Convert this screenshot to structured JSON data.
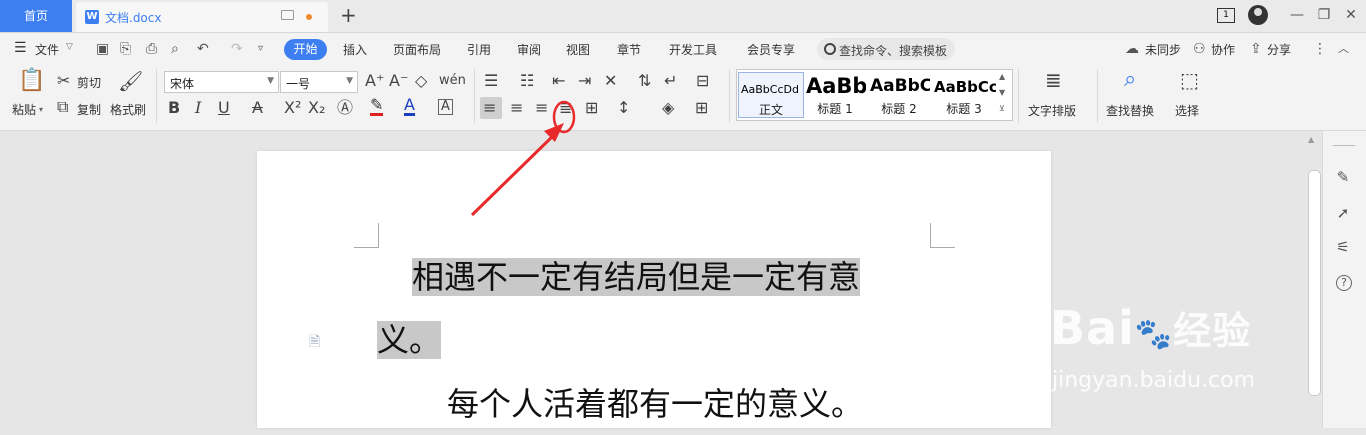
{
  "titlebar": {
    "home_tab": "首页",
    "doc_tab": "文档.docx",
    "doc_icon": "W",
    "new_tab": "+",
    "window_count": "1",
    "min": "—",
    "restore": "❐",
    "close": "✕"
  },
  "menu": {
    "file": "文件",
    "tabs": [
      "开始",
      "插入",
      "页面布局",
      "引用",
      "审阅",
      "视图",
      "章节",
      "开发工具",
      "会员专享"
    ],
    "search": "查找命令、搜索模板",
    "sync": "未同步",
    "collab": "协作",
    "share": "分享"
  },
  "ribbon": {
    "paste": "粘贴",
    "cut": "剪切",
    "copy": "复制",
    "format_painter": "格式刷",
    "font_name": "宋体",
    "font_size": "一号",
    "styles": [
      {
        "sample": "AaBbCcDd",
        "name": "正文"
      },
      {
        "sample": "AaBb",
        "name": "标题 1"
      },
      {
        "sample": "AaBbC",
        "name": "标题 2"
      },
      {
        "sample": "AaBbCc",
        "name": "标题 3"
      }
    ],
    "text_layout": "文字排版",
    "find_replace": "查找替换",
    "select": "选择"
  },
  "document": {
    "para1_line1": "相遇不一定有结局但是一定有意",
    "para1_line2": "义。",
    "para2": "每个人活着都有一定的意义。"
  },
  "watermark": {
    "brand": "Bai",
    "brand_cn": "经验",
    "url": "jingyan.baidu.com"
  },
  "colors": {
    "accent": "#3d7ff0",
    "annotation": "#e82a2a",
    "highlight": "#c8c8c8"
  }
}
